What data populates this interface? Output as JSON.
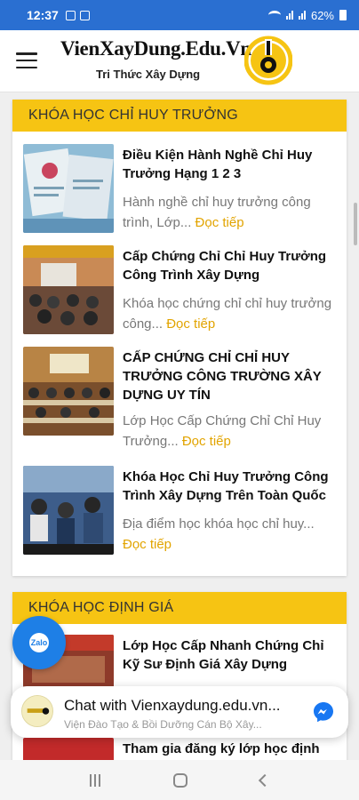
{
  "status": {
    "time": "12:37",
    "battery": "62%"
  },
  "header": {
    "menu_icon": "hamburger-icon",
    "logo_title": "VienXayDung.Edu.Vn",
    "logo_sub": "Tri Thức Xây Dựng"
  },
  "sections": [
    {
      "heading": "KHÓA HỌC CHỈ HUY TRƯỞNG",
      "courses": [
        {
          "title": "Điều Kiện Hành Nghề Chỉ Huy Trưởng Hạng 1 2 3",
          "excerpt": "Hành nghề chỉ huy trưởng công trình, Lớp...",
          "more": "Đọc tiếp"
        },
        {
          "title": "Cấp Chứng Chỉ Chỉ Huy Trưởng Công Trình Xây Dựng",
          "excerpt": "Khóa học chứng chỉ chỉ huy trưởng công...",
          "more": "Đọc tiếp"
        },
        {
          "title": "CẤP CHỨNG CHỈ CHỈ HUY TRƯỞNG CÔNG TRƯỜNG XÂY DỰNG UY TÍN",
          "excerpt": "Lớp Học Cấp Chứng Chỉ Chỉ Huy Trưởng...",
          "more": "Đọc tiếp"
        },
        {
          "title": "Khóa Học Chỉ Huy Trưởng Công Trình Xây Dựng Trên Toàn Quốc",
          "excerpt": " Địa điểm học khóa học chỉ huy...",
          "more": "Đọc tiếp"
        }
      ]
    },
    {
      "heading": "KHÓA HỌC ĐỊNH GIÁ",
      "courses": [
        {
          "title": "Lớp Học Cấp Nhanh Chứng Chỉ Kỹ Sư Định Giá Xây Dựng"
        },
        {
          "title": "Tham gia đăng ký lớp học định"
        }
      ]
    }
  ],
  "chat": {
    "title": "Chat with Vienxaydung.edu.vn...",
    "subtitle": "Viện Đào Tạo & Bồi Dưỡng Cán Bộ Xây...",
    "icon": "messenger-icon"
  },
  "zalo": {
    "label": "Zalo",
    "icon": "zalo-icon"
  },
  "colors": {
    "accent": "#f6c413",
    "link": "#e2a400",
    "status_bar": "#2a6fd1"
  }
}
